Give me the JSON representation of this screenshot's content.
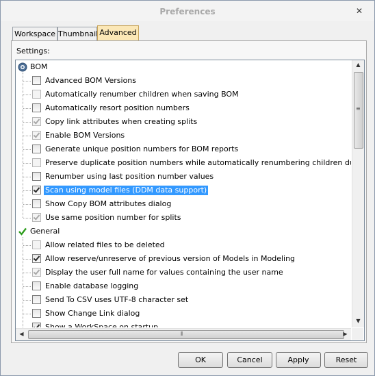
{
  "window": {
    "title": "Preferences",
    "close_glyph": "✕"
  },
  "tabs": [
    {
      "label": "Workspace",
      "active": false
    },
    {
      "label": "Thumbnail",
      "active": false
    },
    {
      "label": "Advanced",
      "active": true
    }
  ],
  "settings_label": "Settings:",
  "groups": {
    "bom": {
      "label": "BOM",
      "icon": "bom-gear-icon",
      "items": [
        {
          "label": "Advanced BOM Versions",
          "checked": false,
          "enabled": true
        },
        {
          "label": "Automatically renumber children when saving BOM",
          "checked": false,
          "enabled": false
        },
        {
          "label": "Automatically resort position numbers",
          "checked": false,
          "enabled": true
        },
        {
          "label": "Copy link attributes when creating splits",
          "checked": true,
          "enabled": false
        },
        {
          "label": "Enable BOM Versions",
          "checked": true,
          "enabled": false
        },
        {
          "label": "Generate unique position numbers for BOM reports",
          "checked": false,
          "enabled": true
        },
        {
          "label": "Preserve duplicate position numbers while automatically renumbering children during BOM sav",
          "checked": false,
          "enabled": false
        },
        {
          "label": "Renumber using last position number values",
          "checked": false,
          "enabled": true
        },
        {
          "label": "Scan using model files (DDM data support)",
          "checked": true,
          "enabled": true,
          "selected": true
        },
        {
          "label": "Show Copy BOM attributes dialog",
          "checked": false,
          "enabled": true
        },
        {
          "label": "Use same position number for splits",
          "checked": true,
          "enabled": false
        }
      ]
    },
    "general": {
      "label": "General",
      "icon": "green-check-icon",
      "items": [
        {
          "label": "Allow related files to be deleted",
          "checked": false,
          "enabled": false
        },
        {
          "label": "Allow reserve/unreserve of previous version of Models in Modeling",
          "checked": true,
          "enabled": true
        },
        {
          "label": "Display the user full name for values containing the user name",
          "checked": true,
          "enabled": false
        },
        {
          "label": "Enable database logging",
          "checked": false,
          "enabled": true
        },
        {
          "label": "Send To CSV uses UTF-8 character set",
          "checked": false,
          "enabled": true
        },
        {
          "label": "Show Change Link dialog",
          "checked": false,
          "enabled": true
        },
        {
          "label": "Show a WorkSpace on startup",
          "checked": true,
          "enabled": true
        }
      ]
    }
  },
  "buttons": {
    "ok": "OK",
    "cancel": "Cancel",
    "apply": "Apply",
    "reset": "Reset"
  },
  "colors": {
    "selection": "#3399ff",
    "active_tab": "#fbe7b6",
    "check_green": "#2e9d1e"
  }
}
